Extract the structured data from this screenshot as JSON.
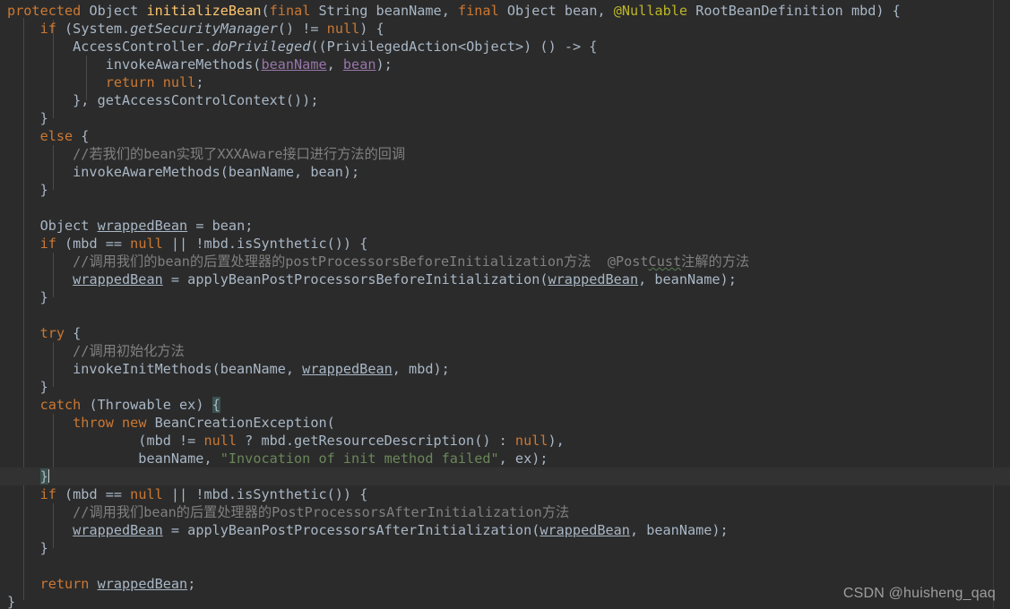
{
  "editor": {
    "background": "#2b2b2b",
    "current_line_background": "#323232",
    "margin_guide_color": "#3c3f41",
    "indent_guide_color": "#4a4a4a",
    "font_size_px": 15.2,
    "line_height_px": 20,
    "current_line_index": 26,
    "colors": {
      "default_text": "#a9b7c6",
      "keyword": "#cc7832",
      "method_declaration": "#ffc66d",
      "annotation": "#bbb529",
      "string": "#6a8759",
      "comment": "#808080",
      "field_reference": "#9876aa",
      "matched_brace_background": "#3b514d",
      "typo_underline": "#5a7d5a",
      "caret": "#cfcfcf"
    }
  },
  "watermark": {
    "text": "CSDN @huisheng_qaq"
  },
  "code": {
    "language": "java",
    "lines": [
      "protected Object initializeBean(final String beanName, final Object bean, @Nullable RootBeanDefinition mbd) {",
      "    if (System.getSecurityManager() != null) {",
      "        AccessController.doPrivileged((PrivilegedAction<Object>) () -> {",
      "            invokeAwareMethods(beanName, bean);",
      "            return null;",
      "        }, getAccessControlContext());",
      "    }",
      "    else {",
      "        //若我们的bean实现了XXXAware接口进行方法的回调",
      "        invokeAwareMethods(beanName, bean);",
      "    }",
      "",
      "    Object wrappedBean = bean;",
      "    if (mbd == null || !mbd.isSynthetic()) {",
      "        //调用我们的bean的后置处理器的postProcessorsBeforeInitialization方法  @PostCust注解的方法",
      "        wrappedBean = applyBeanPostProcessorsBeforeInitialization(wrappedBean, beanName);",
      "    }",
      "",
      "    try {",
      "        //调用初始化方法",
      "        invokeInitMethods(beanName, wrappedBean, mbd);",
      "    }",
      "    catch (Throwable ex) {",
      "        throw new BeanCreationException(",
      "                (mbd != null ? mbd.getResourceDescription() : null),",
      "                beanName, \"Invocation of init method failed\", ex);",
      "    }",
      "    if (mbd == null || !mbd.isSynthetic()) {",
      "        //调用我们bean的后置处理器的PostProcessorsAfterInitialization方法",
      "        wrappedBean = applyBeanPostProcessorsAfterInitialization(wrappedBean, beanName);",
      "    }",
      "",
      "    return wrappedBean;",
      "}"
    ],
    "tokens": {
      "keywords": [
        "protected",
        "if",
        "else",
        "return",
        "try",
        "catch",
        "throw",
        "new",
        "final",
        "null"
      ],
      "method_name": "initializeBean",
      "annotation": "@Nullable",
      "string_literal": "\"Invocation of init method failed\"",
      "field_references": [
        "beanName",
        "bean"
      ],
      "local_variable": "wrappedBean",
      "static_calls": [
        "getSecurityManager",
        "doPrivileged"
      ],
      "spellcheck_typo": "Cust"
    }
  }
}
